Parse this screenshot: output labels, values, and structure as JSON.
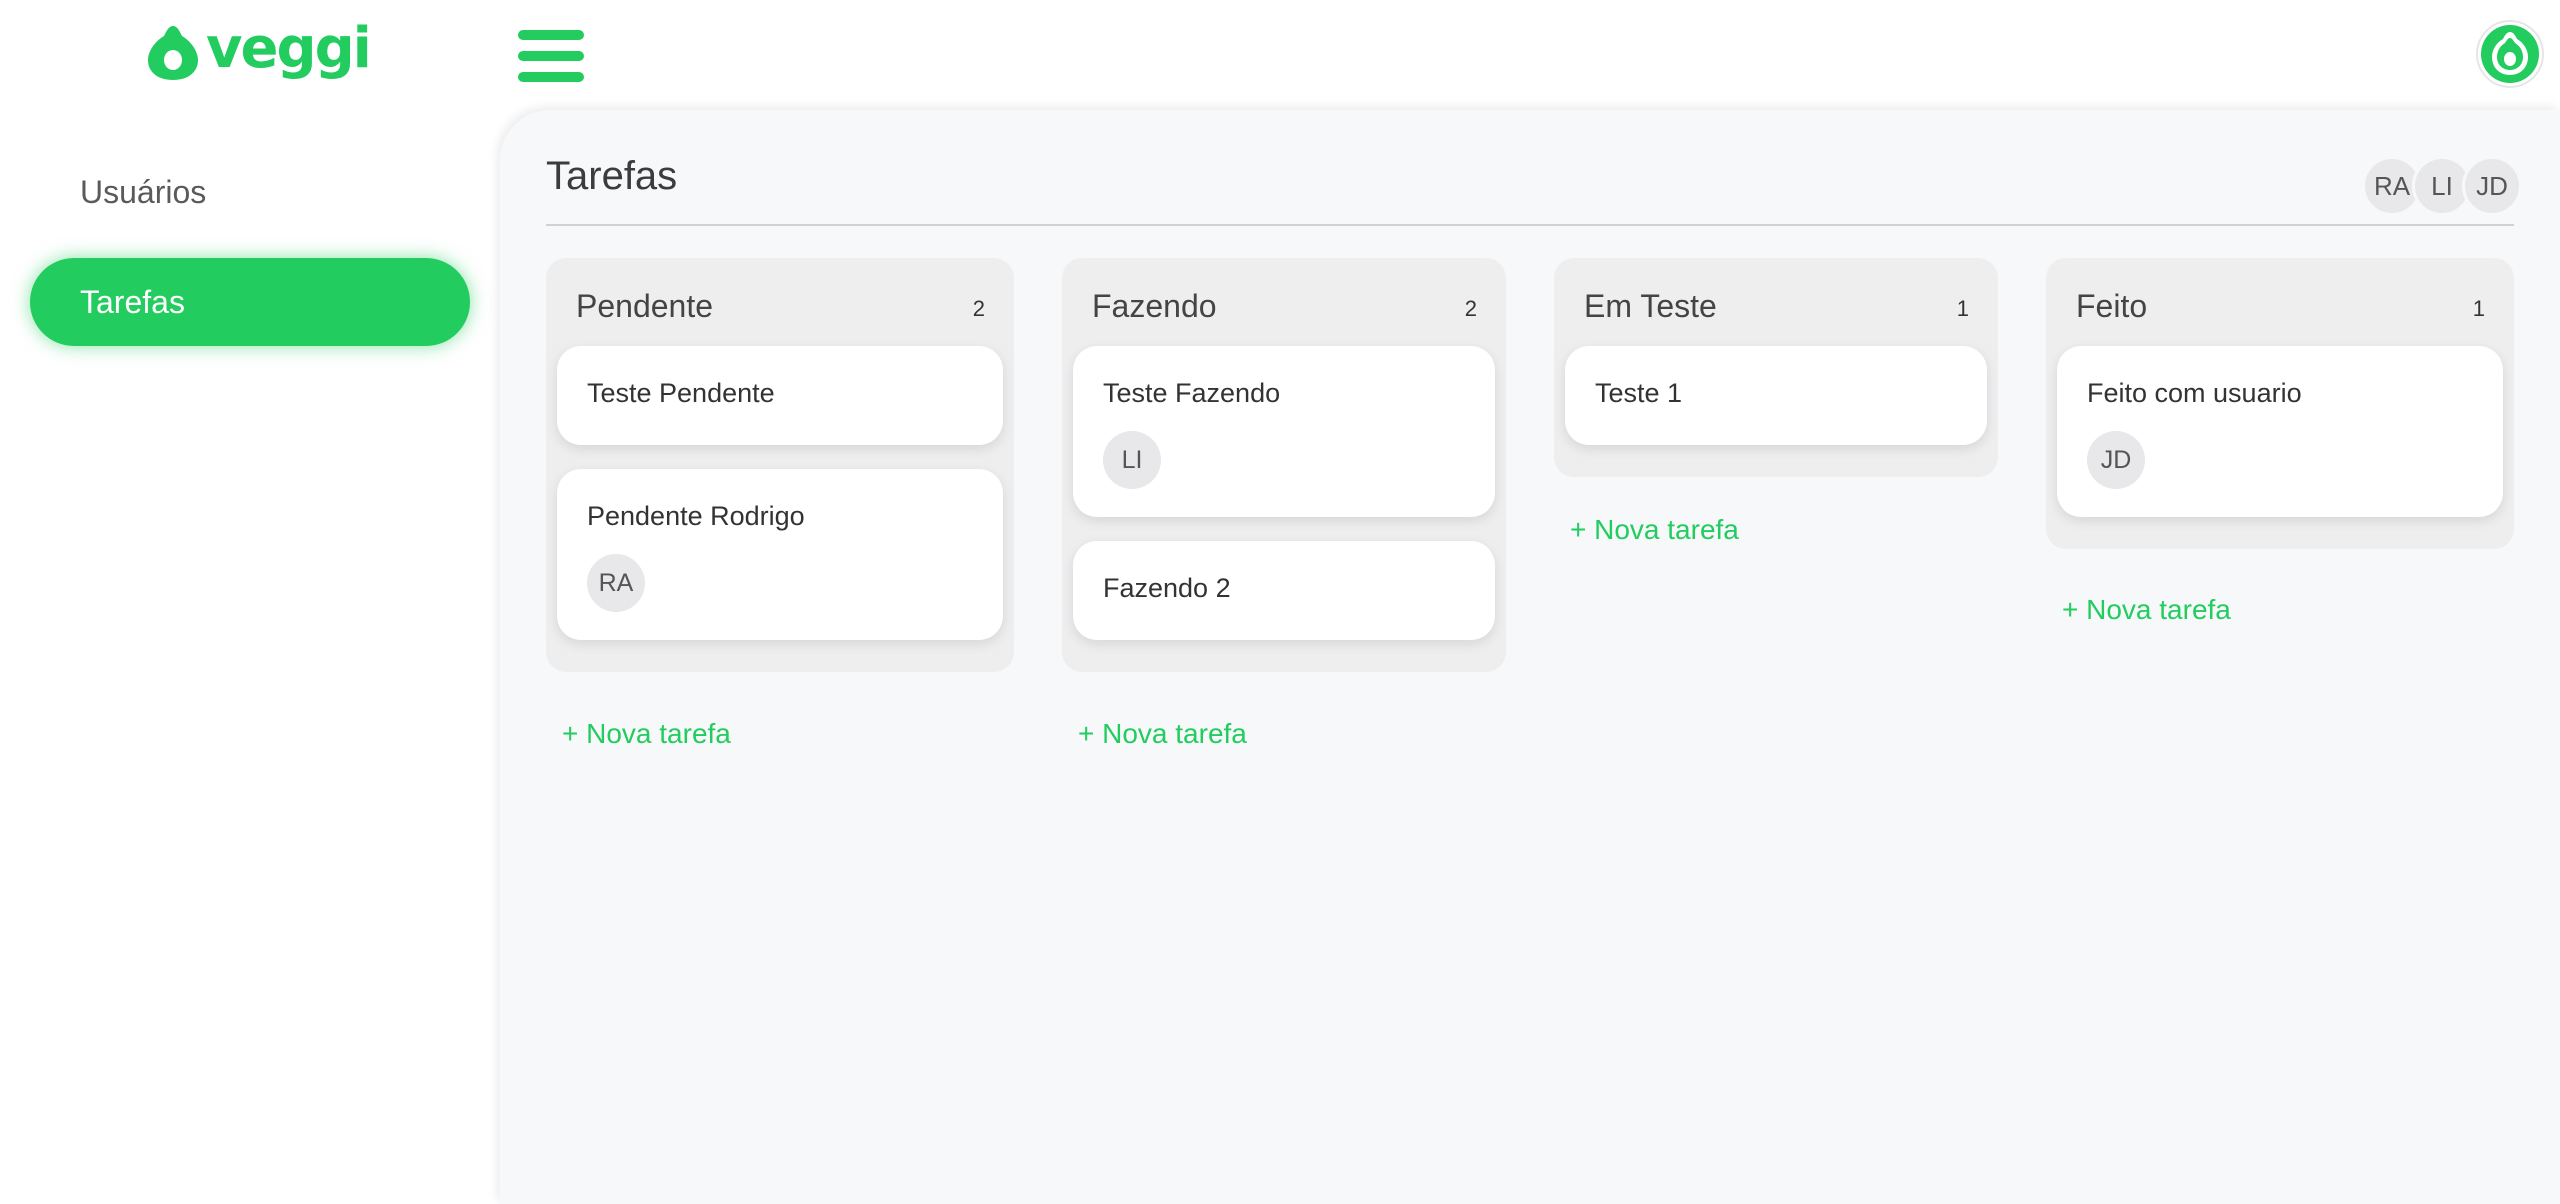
{
  "brand": {
    "name": "veggi",
    "color": "#22cc5e",
    "icon": "avocado-icon"
  },
  "header": {
    "menu_icon": "hamburger-menu-icon",
    "user_avatar_icon": "avocado-icon"
  },
  "sidebar": {
    "items": [
      {
        "label": "Usuários",
        "active": false
      },
      {
        "label": "Tarefas",
        "active": true
      }
    ]
  },
  "main": {
    "title": "Tarefas",
    "members": [
      "RA",
      "LI",
      "JD"
    ],
    "columns": [
      {
        "title": "Pendente",
        "count": "2",
        "cards": [
          {
            "title": "Teste Pendente",
            "assignee": ""
          },
          {
            "title": "Pendente Rodrigo",
            "assignee": "RA"
          }
        ],
        "new_task_label": "+ Nova tarefa"
      },
      {
        "title": "Fazendo",
        "count": "2",
        "cards": [
          {
            "title": "Teste Fazendo",
            "assignee": "LI"
          },
          {
            "title": "Fazendo 2",
            "assignee": ""
          }
        ],
        "new_task_label": "+ Nova tarefa"
      },
      {
        "title": "Em Teste",
        "count": "1",
        "cards": [
          {
            "title": "Teste 1",
            "assignee": ""
          }
        ],
        "new_task_label": "+ Nova tarefa"
      },
      {
        "title": "Feito",
        "count": "1",
        "cards": [
          {
            "title": "Feito com usuario",
            "assignee": "JD"
          }
        ],
        "new_task_label": "+ Nova tarefa"
      }
    ]
  }
}
